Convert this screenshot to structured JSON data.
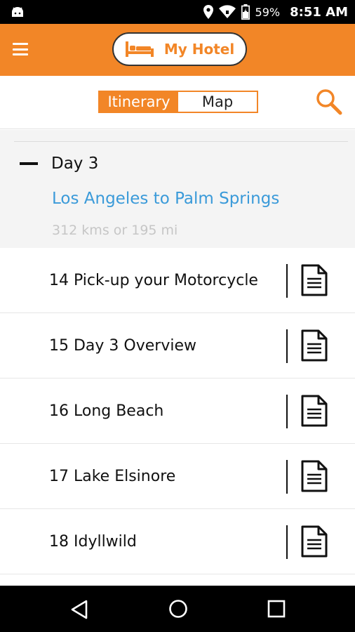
{
  "status_bar": {
    "battery": "59%",
    "time": "8:51 AM"
  },
  "header": {
    "hotel_button_label": "My Hotel"
  },
  "toolbar": {
    "tabs": [
      {
        "label": "Itinerary"
      },
      {
        "label": "Map"
      }
    ]
  },
  "day": {
    "title": "Day 3",
    "route": "Los Angeles to Palm Springs",
    "distance": "312 kms or 195 mi"
  },
  "items": [
    {
      "label": "14 Pick-up your Motorcycle"
    },
    {
      "label": "15 Day 3 Overview"
    },
    {
      "label": "16 Long Beach"
    },
    {
      "label": "17 Lake Elsinore"
    },
    {
      "label": "18 Idyllwild"
    }
  ],
  "colors": {
    "accent": "#f28627",
    "link": "#3a9ad9"
  }
}
